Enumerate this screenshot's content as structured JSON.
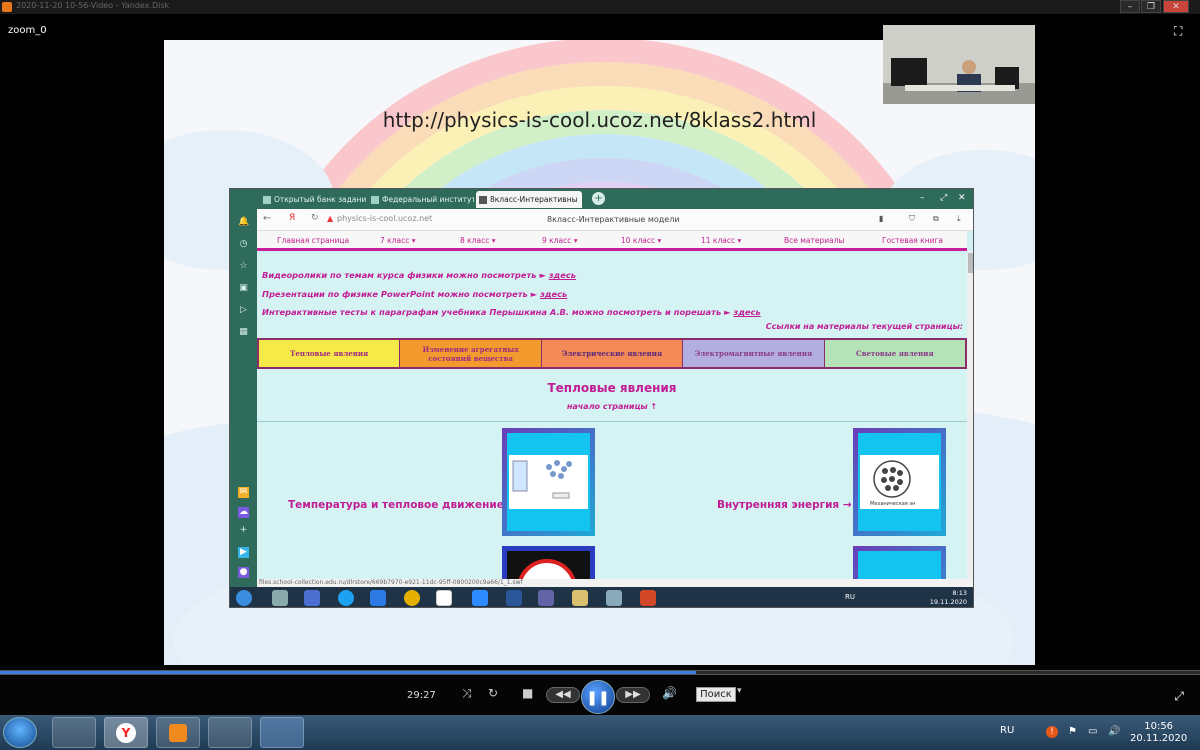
{
  "player": {
    "window_title": "2020-11-20 10-56-Video - Yandex.Disk",
    "window_label": "zoom_0",
    "time": "29:27",
    "search_label": "Поиск",
    "progress_fraction": 0.58
  },
  "slide": {
    "url_title": "http://physics-is-cool.ucoz.net/8klass2.html"
  },
  "browser": {
    "tabs": [
      {
        "label": "Открытый банк заданий"
      },
      {
        "label": "Федеральный институт п"
      },
      {
        "label": "8класс-Интерактивны"
      }
    ],
    "address": "physics-is-cool.ucoz.net",
    "page_title": "8класс-Интерактивные модели",
    "status_url": "files.school-collection.edu.ru/dlrstore/669b7970-e921-11dc-95ff-0800200c9a66/1_1.swf",
    "menu": [
      "Главная страница",
      "7 класс ▾",
      "8 класс ▾",
      "9 класс ▾",
      "10 класс ▾",
      "11 класс ▾",
      "Все материалы",
      "Гостевая книга"
    ],
    "lines": [
      {
        "text": "Видеоролики по темам курса физики можно посмотреть ► ",
        "link": "здесь"
      },
      {
        "text": "Презентации по физике PowerPoint можно посмотреть ► ",
        "link": "здесь"
      },
      {
        "text": "Интерактивные тесты к параграфам учебника Перышкина А.В. можно посмотреть и порешать ► ",
        "link": "здесь"
      }
    ],
    "links_label": "Ссылки на материалы текущей страницы:",
    "nav_cells": [
      {
        "label": "Тепловые явления",
        "color": "#f5ea48",
        "text_color": "#a12a80"
      },
      {
        "label": "Изменение агрегатных состояний вещества",
        "color": "#f29a2e",
        "text_color": "#a12a80"
      },
      {
        "label": "Электрические явления",
        "color": "#f48a58",
        "text_color": "#5c2a7a"
      },
      {
        "label": "Электромагнитные явления",
        "color": "#b3aee0",
        "text_color": "#8a3a8a"
      },
      {
        "label": "Световые явления",
        "color": "#b6e2b8",
        "text_color": "#8a3a8a"
      }
    ],
    "section_title": "Тепловые явления",
    "to_page_top": "начало страницы ↑",
    "topics": [
      {
        "label": "Температура и тепловое движение →"
      },
      {
        "label": "Внутренняя энергия →"
      }
    ],
    "thumb_caption": "Механическая эн",
    "inner_clock_time": "8:13",
    "inner_clock_date": "19.11.2020",
    "inner_lang": "RU"
  },
  "taskbar": {
    "lang": "RU",
    "time": "10:56",
    "date": "20.11.2020"
  }
}
